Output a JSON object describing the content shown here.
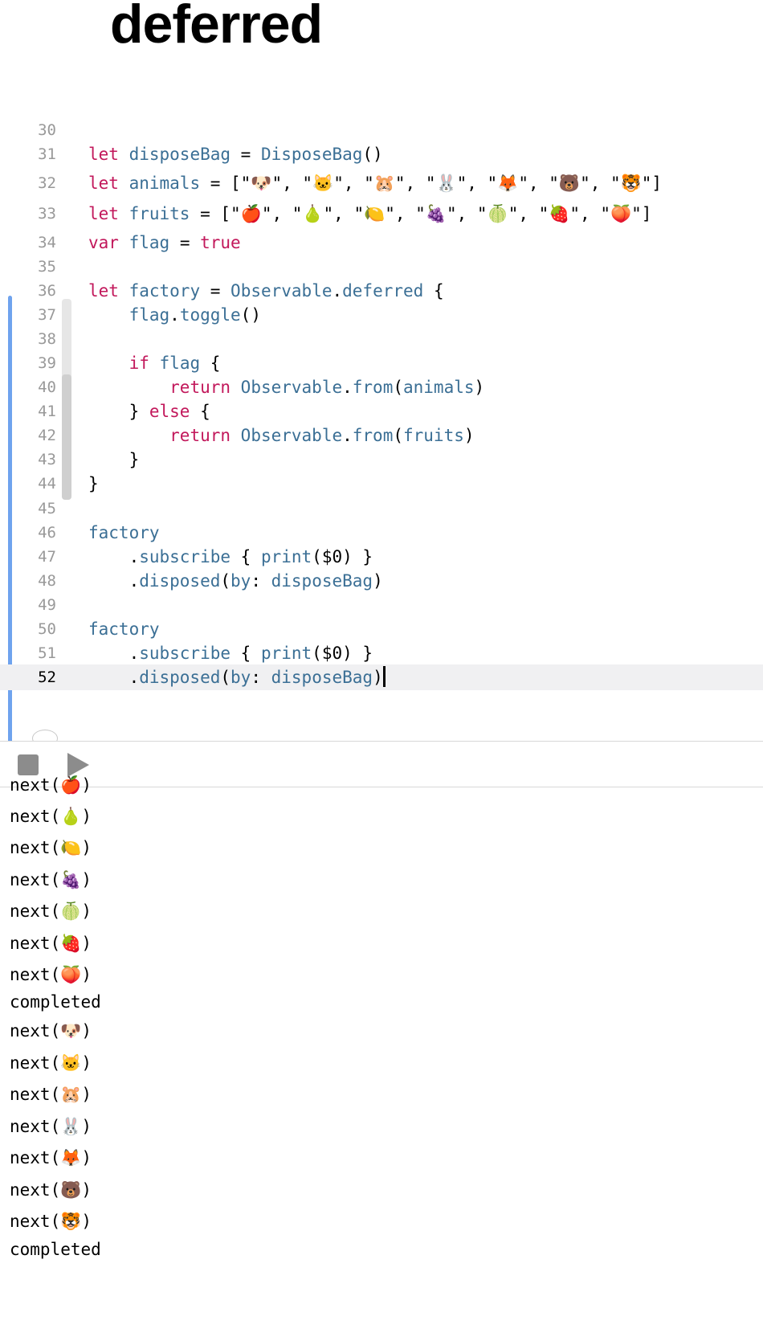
{
  "page": {
    "title": "deferred"
  },
  "editor": {
    "current_line": 52,
    "lines": [
      {
        "num": "30",
        "tokens": []
      },
      {
        "num": "31",
        "tokens": [
          {
            "c": "k",
            "t": "let"
          },
          {
            "c": "s",
            "t": " "
          },
          {
            "c": "t",
            "t": "disposeBag"
          },
          {
            "c": "s",
            "t": " = "
          },
          {
            "c": "t",
            "t": "DisposeBag"
          },
          {
            "c": "s",
            "t": "()"
          }
        ]
      },
      {
        "num": "32",
        "tokens": [
          {
            "c": "k",
            "t": "let"
          },
          {
            "c": "s",
            "t": " "
          },
          {
            "c": "t",
            "t": "animals"
          },
          {
            "c": "s",
            "t": " = [\"🐶\", \"🐱\", \"🐹\", \"🐰\", \"🦊\", \"🐻\", \"🐯\"]"
          }
        ]
      },
      {
        "num": "33",
        "tokens": [
          {
            "c": "k",
            "t": "let"
          },
          {
            "c": "s",
            "t": " "
          },
          {
            "c": "t",
            "t": "fruits"
          },
          {
            "c": "s",
            "t": " = [\"🍎\", \"🍐\", \"🍋\", \"🍇\", \"🍈\", \"🍓\", \"🍑\"]"
          }
        ]
      },
      {
        "num": "34",
        "tokens": [
          {
            "c": "k",
            "t": "var"
          },
          {
            "c": "s",
            "t": " "
          },
          {
            "c": "t",
            "t": "flag"
          },
          {
            "c": "s",
            "t": " = "
          },
          {
            "c": "k",
            "t": "true"
          }
        ]
      },
      {
        "num": "35",
        "tokens": []
      },
      {
        "num": "36",
        "tokens": [
          {
            "c": "k",
            "t": "let"
          },
          {
            "c": "s",
            "t": " "
          },
          {
            "c": "t",
            "t": "factory"
          },
          {
            "c": "s",
            "t": " = "
          },
          {
            "c": "t",
            "t": "Observable"
          },
          {
            "c": "s",
            "t": "."
          },
          {
            "c": "t",
            "t": "deferred"
          },
          {
            "c": "s",
            "t": " {"
          }
        ]
      },
      {
        "num": "37",
        "tokens": [
          {
            "c": "s",
            "t": "    "
          },
          {
            "c": "t",
            "t": "flag"
          },
          {
            "c": "s",
            "t": "."
          },
          {
            "c": "t",
            "t": "toggle"
          },
          {
            "c": "s",
            "t": "()"
          }
        ]
      },
      {
        "num": "38",
        "tokens": []
      },
      {
        "num": "39",
        "tokens": [
          {
            "c": "s",
            "t": "    "
          },
          {
            "c": "k",
            "t": "if"
          },
          {
            "c": "s",
            "t": " "
          },
          {
            "c": "t",
            "t": "flag"
          },
          {
            "c": "s",
            "t": " {"
          }
        ]
      },
      {
        "num": "40",
        "tokens": [
          {
            "c": "s",
            "t": "        "
          },
          {
            "c": "k",
            "t": "return"
          },
          {
            "c": "s",
            "t": " "
          },
          {
            "c": "t",
            "t": "Observable"
          },
          {
            "c": "s",
            "t": "."
          },
          {
            "c": "t",
            "t": "from"
          },
          {
            "c": "s",
            "t": "("
          },
          {
            "c": "t",
            "t": "animals"
          },
          {
            "c": "s",
            "t": ")"
          }
        ]
      },
      {
        "num": "41",
        "tokens": [
          {
            "c": "s",
            "t": "    } "
          },
          {
            "c": "k",
            "t": "else"
          },
          {
            "c": "s",
            "t": " {"
          }
        ]
      },
      {
        "num": "42",
        "tokens": [
          {
            "c": "s",
            "t": "        "
          },
          {
            "c": "k",
            "t": "return"
          },
          {
            "c": "s",
            "t": " "
          },
          {
            "c": "t",
            "t": "Observable"
          },
          {
            "c": "s",
            "t": "."
          },
          {
            "c": "t",
            "t": "from"
          },
          {
            "c": "s",
            "t": "("
          },
          {
            "c": "t",
            "t": "fruits"
          },
          {
            "c": "s",
            "t": ")"
          }
        ]
      },
      {
        "num": "43",
        "tokens": [
          {
            "c": "s",
            "t": "    }"
          }
        ]
      },
      {
        "num": "44",
        "tokens": [
          {
            "c": "s",
            "t": "}"
          }
        ]
      },
      {
        "num": "45",
        "tokens": []
      },
      {
        "num": "46",
        "tokens": [
          {
            "c": "t",
            "t": "factory"
          }
        ]
      },
      {
        "num": "47",
        "tokens": [
          {
            "c": "s",
            "t": "    ."
          },
          {
            "c": "t",
            "t": "subscribe"
          },
          {
            "c": "s",
            "t": " { "
          },
          {
            "c": "t",
            "t": "print"
          },
          {
            "c": "s",
            "t": "($0) }"
          }
        ]
      },
      {
        "num": "48",
        "tokens": [
          {
            "c": "s",
            "t": "    ."
          },
          {
            "c": "t",
            "t": "disposed"
          },
          {
            "c": "s",
            "t": "("
          },
          {
            "c": "t",
            "t": "by"
          },
          {
            "c": "s",
            "t": ": "
          },
          {
            "c": "t",
            "t": "disposeBag"
          },
          {
            "c": "s",
            "t": ")"
          }
        ]
      },
      {
        "num": "49",
        "tokens": []
      },
      {
        "num": "50",
        "tokens": [
          {
            "c": "t",
            "t": "factory"
          }
        ]
      },
      {
        "num": "51",
        "tokens": [
          {
            "c": "s",
            "t": "    ."
          },
          {
            "c": "t",
            "t": "subscribe"
          },
          {
            "c": "s",
            "t": " { "
          },
          {
            "c": "t",
            "t": "print"
          },
          {
            "c": "s",
            "t": "($0) }"
          }
        ]
      },
      {
        "num": "52",
        "tokens": [
          {
            "c": "s",
            "t": "    ."
          },
          {
            "c": "t",
            "t": "disposed"
          },
          {
            "c": "s",
            "t": "("
          },
          {
            "c": "t",
            "t": "by"
          },
          {
            "c": "s",
            "t": ": "
          },
          {
            "c": "t",
            "t": "disposeBag"
          },
          {
            "c": "s",
            "t": ")"
          }
        ]
      }
    ]
  },
  "toolbar": {
    "stop_icon": "stop-icon",
    "play_icon": "play-icon"
  },
  "console": {
    "output": [
      "next(🍎)",
      "next(🍐)",
      "next(🍋)",
      "next(🍇)",
      "next(🍈)",
      "next(🍓)",
      "next(🍑)",
      "completed",
      "next(🐶)",
      "next(🐱)",
      "next(🐹)",
      "next(🐰)",
      "next(🦊)",
      "next(🐻)",
      "next(🐯)",
      "completed"
    ]
  },
  "colors": {
    "keyword": "#c2185b",
    "identifier": "#3b6f95",
    "change_bar": "#6fa3ee",
    "current_line_bg": "#f0f0f2"
  }
}
